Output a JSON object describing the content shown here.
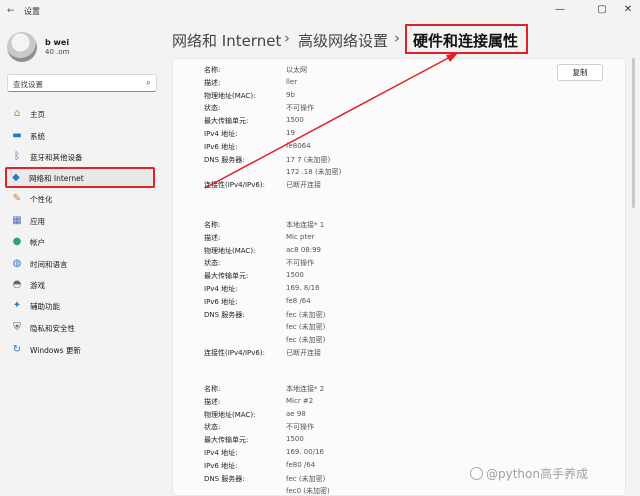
{
  "window": {
    "title": "设置",
    "minimize": "—",
    "maximize": "▢",
    "close": "✕"
  },
  "user": {
    "name": "b wei",
    "email": "40 .om"
  },
  "search": {
    "placeholder": "查找设置"
  },
  "nav": [
    {
      "label": "主页",
      "icon": "home-icon",
      "glyph": "⌂",
      "color": "#c0862f"
    },
    {
      "label": "系统",
      "icon": "monitor-icon",
      "glyph": "▬",
      "color": "#2a78c9"
    },
    {
      "label": "蓝牙和其他设备",
      "icon": "bluetooth-icon",
      "glyph": "ᛒ",
      "color": "#2a78c9"
    },
    {
      "label": "网络和 Internet",
      "icon": "wifi-icon",
      "glyph": "◆",
      "color": "#2a78c9",
      "active": true
    },
    {
      "label": "个性化",
      "icon": "brush-icon",
      "glyph": "✎",
      "color": "#d07a2a"
    },
    {
      "label": "应用",
      "icon": "apps-icon",
      "glyph": "▦",
      "color": "#4a6fb5"
    },
    {
      "label": "帐户",
      "icon": "account-icon",
      "glyph": "●",
      "color": "#2ea36b"
    },
    {
      "label": "时间和语言",
      "icon": "globe-icon",
      "glyph": "◍",
      "color": "#2a78c9"
    },
    {
      "label": "游戏",
      "icon": "gamepad-icon",
      "glyph": "◓",
      "color": "#666"
    },
    {
      "label": "辅助功能",
      "icon": "accessibility-icon",
      "glyph": "✦",
      "color": "#2a78c9"
    },
    {
      "label": "隐私和安全性",
      "icon": "shield-icon",
      "glyph": "⛨",
      "color": "#555"
    },
    {
      "label": "Windows 更新",
      "icon": "update-icon",
      "glyph": "↻",
      "color": "#2a78c9"
    }
  ],
  "breadcrumb": {
    "item1": "网络和 Internet",
    "item2": "高级网络设置",
    "current": "硬件和连接属性",
    "sep": "›"
  },
  "copy_button": "复制",
  "adapters": [
    {
      "rows": [
        {
          "k": "名称:",
          "v": "以太网"
        },
        {
          "k": "描述:",
          "v": "ller"
        },
        {
          "k": "物理地址(MAC):",
          "v": "9b"
        },
        {
          "k": "状态:",
          "v": "不可操作"
        },
        {
          "k": "最大传输单元:",
          "v": "1500"
        },
        {
          "k": "IPv4 地址:",
          "v": "19"
        },
        {
          "k": "IPv6 地址:",
          "v": "fe8064"
        },
        {
          "k": "DNS 服务器:",
          "v": "17 7 (未加密)"
        },
        {
          "k": "",
          "v": "172 .18 (未加密)"
        },
        {
          "k": "连接性(IPv4/IPv6):",
          "v": "已断开连接"
        }
      ]
    },
    {
      "rows": [
        {
          "k": "名称:",
          "v": "本地连接* 1"
        },
        {
          "k": "描述:",
          "v": "Mic pter"
        },
        {
          "k": "物理地址(MAC):",
          "v": "ac8 08:99"
        },
        {
          "k": "状态:",
          "v": "不可操作"
        },
        {
          "k": "最大传输单元:",
          "v": "1500"
        },
        {
          "k": "IPv4 地址:",
          "v": "169. 8/16"
        },
        {
          "k": "IPv6 地址:",
          "v": "fe8 /64"
        },
        {
          "k": "DNS 服务器:",
          "v": "fec (未加密)"
        },
        {
          "k": "",
          "v": "fec (未加密)"
        },
        {
          "k": "",
          "v": "fec (未加密)"
        },
        {
          "k": "连接性(IPv4/IPv6):",
          "v": "已断开连接"
        }
      ]
    },
    {
      "rows": [
        {
          "k": "名称:",
          "v": "本地连接* 2"
        },
        {
          "k": "描述:",
          "v": "Micr #2"
        },
        {
          "k": "物理地址(MAC):",
          "v": "ae 98"
        },
        {
          "k": "状态:",
          "v": "不可操作"
        },
        {
          "k": "最大传输单元:",
          "v": "1500"
        },
        {
          "k": "IPv4 地址:",
          "v": "169. 00/16"
        },
        {
          "k": "IPv6 地址:",
          "v": "fe80 /64"
        },
        {
          "k": "DNS 服务器:",
          "v": "fec (未加密)"
        },
        {
          "k": "",
          "v": "fec0 (未加密)"
        }
      ]
    }
  ],
  "watermark": "@python高手养成"
}
